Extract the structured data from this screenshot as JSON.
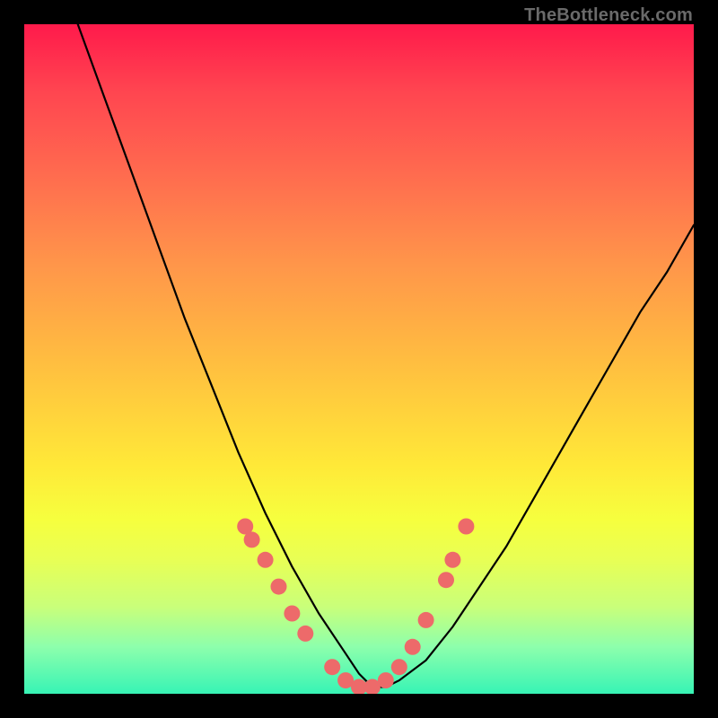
{
  "attribution": "TheBottleneck.com",
  "chart_data": {
    "type": "line",
    "title": "",
    "xlabel": "",
    "ylabel": "",
    "xlim": [
      0,
      100
    ],
    "ylim": [
      0,
      100
    ],
    "series": [
      {
        "name": "bottleneck-curve",
        "x": [
          8,
          12,
          16,
          20,
          24,
          28,
          32,
          36,
          40,
          44,
          48,
          50,
          52,
          54,
          56,
          60,
          64,
          68,
          72,
          76,
          80,
          84,
          88,
          92,
          96,
          100
        ],
        "values": [
          100,
          89,
          78,
          67,
          56,
          46,
          36,
          27,
          19,
          12,
          6,
          3,
          1,
          1,
          2,
          5,
          10,
          16,
          22,
          29,
          36,
          43,
          50,
          57,
          63,
          70
        ]
      }
    ],
    "markers": {
      "name": "highlight-dots",
      "x": [
        33,
        34,
        36,
        38,
        40,
        42,
        46,
        48,
        50,
        52,
        54,
        56,
        58,
        60,
        63,
        64,
        66
      ],
      "values": [
        25,
        23,
        20,
        16,
        12,
        9,
        4,
        2,
        1,
        1,
        2,
        4,
        7,
        11,
        17,
        20,
        25
      ]
    },
    "marker_color": "#ed6a6a",
    "curve_color": "#000000"
  }
}
